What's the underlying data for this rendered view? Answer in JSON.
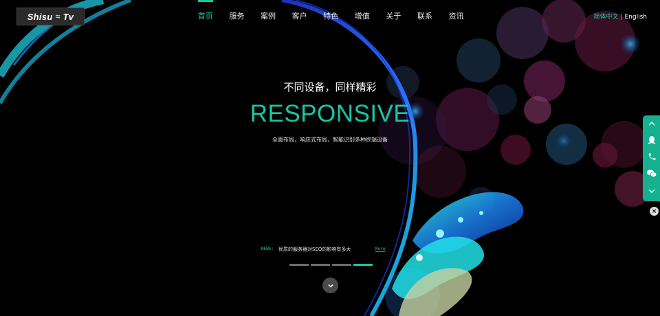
{
  "header": {
    "logo_text_left": "Shisu",
    "logo_text_right": "Tv",
    "nav": [
      {
        "label": "首页",
        "active": true
      },
      {
        "label": "服务",
        "active": false
      },
      {
        "label": "案例",
        "active": false
      },
      {
        "label": "客户",
        "active": false
      },
      {
        "label": "特色",
        "active": false
      },
      {
        "label": "增值",
        "active": false
      },
      {
        "label": "关于",
        "active": false
      },
      {
        "label": "联系",
        "active": false
      },
      {
        "label": "资讯",
        "active": false
      }
    ],
    "lang": {
      "zh": "简体中文",
      "separator": "|",
      "en": "English"
    }
  },
  "hero": {
    "subtitle": "不同设备，同样精彩",
    "title": "RESPONSIVE",
    "description": "全面布局，响应式布局，智能识别多种终端设备"
  },
  "news": {
    "tag": "NEWS:",
    "headline": "优质的服务器对SEO的影响有多大",
    "more": "More"
  },
  "slider": {
    "count": 4,
    "active_index": 3
  },
  "side_tools": [
    "qq-icon",
    "phone-icon",
    "wechat-icon",
    "chevron-down-icon"
  ],
  "colors": {
    "accent": "#14c9a6",
    "background": "#000000",
    "side_bar": "#15b08e"
  }
}
